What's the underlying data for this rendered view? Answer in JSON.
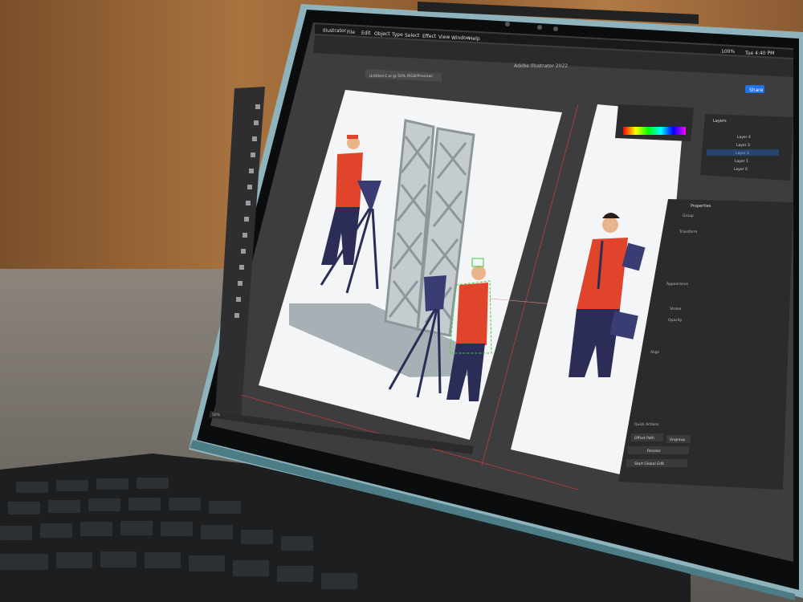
{
  "menu": [
    "Illustrator",
    "File",
    "Edit",
    "Object",
    "Type",
    "Select",
    "Effect",
    "View",
    "Window",
    "Help"
  ],
  "doc_tab": "Untitled-1.ai @ 50% (RGB/Preview)",
  "app_title": "Adobe Illustrator 2022",
  "clock": "Tue 4:40 PM",
  "battery": "100%",
  "share_label": "Share",
  "layers_title": "Layers",
  "layers": [
    "Layer 4",
    "Layer 3",
    "Layer 2",
    "Layer 1",
    "Layer 0"
  ],
  "properties_title": "Properties",
  "panel_labels": [
    "Group",
    "Transform",
    "Appearance",
    "Stroke",
    "Opacity",
    "Align",
    "Quick Actions"
  ],
  "quick_actions": [
    "Offset Path",
    "Ungroup",
    "Recolor",
    "Start Global Edit"
  ],
  "zoom": "50%",
  "colors": {
    "accent": "#1e73e8",
    "shirt": "#e0442a",
    "pants": "#2b2d57",
    "pillar": "#a9b3b8",
    "selection": "#36d236"
  }
}
